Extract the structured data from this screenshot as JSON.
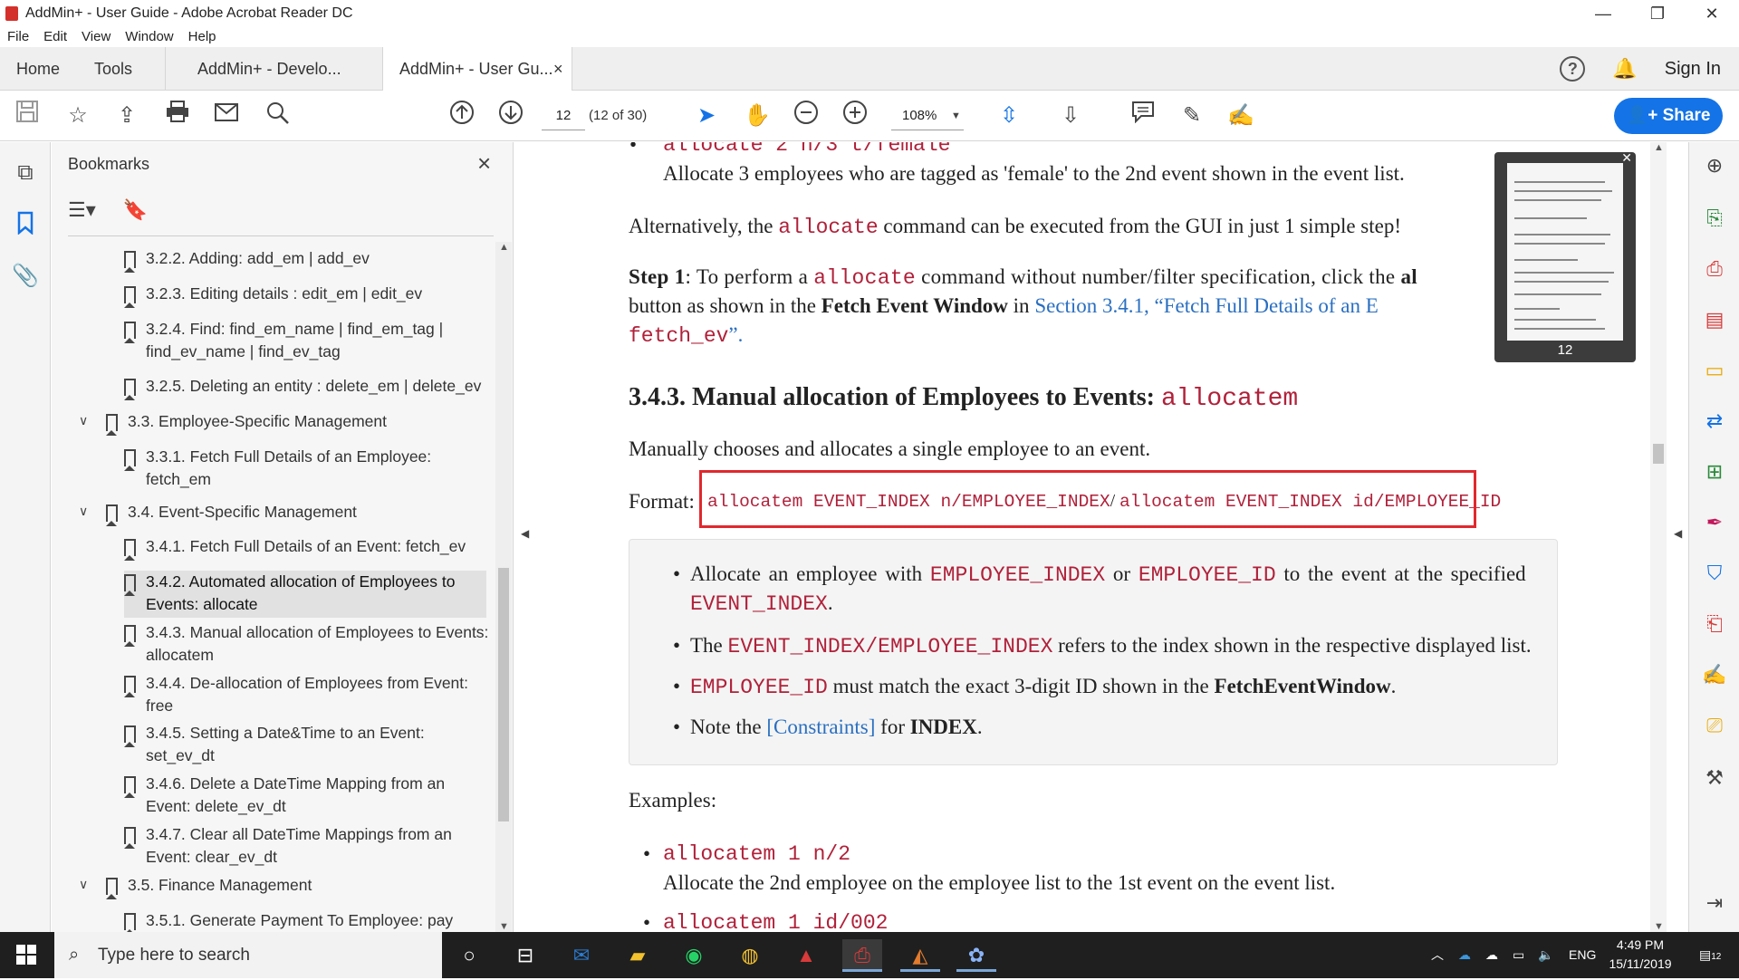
{
  "window": {
    "title": "AddMin+ - User Guide - Adobe Acrobat Reader DC",
    "minimize": "—",
    "restore": "❐",
    "close": "✕"
  },
  "menu": [
    "File",
    "Edit",
    "View",
    "Window",
    "Help"
  ],
  "tabs": {
    "home": "Home",
    "tools": "Tools",
    "doc1": "AddMin+ - Develo...",
    "doc2": "AddMin+ - User Gu...",
    "doc2_close": "×",
    "sign_in": "Sign In"
  },
  "toolbar": {
    "page_input": "12",
    "page_count": "(12 of 30)",
    "zoom": "108%",
    "share": "Share"
  },
  "bookmarks": {
    "title": "Bookmarks",
    "items": [
      {
        "label": "3.2.2. Adding: add_em | add_ev"
      },
      {
        "label": "3.2.3. Editing details : edit_em | edit_ev"
      },
      {
        "label": "3.2.4. Find: find_em_name | find_em_tag | find_ev_name | find_ev_tag"
      },
      {
        "label": "3.2.5. Deleting an entity : delete_em | delete_ev"
      },
      {
        "label": "3.3. Employee-Specific Management"
      },
      {
        "label": "3.3.1. Fetch Full Details of an Employee: fetch_em"
      },
      {
        "label": "3.4. Event-Specific Management"
      },
      {
        "label": "3.4.1. Fetch Full Details of an Event: fetch_ev"
      },
      {
        "label": "3.4.2. Automated allocation of Employees to Events: allocate"
      },
      {
        "label": "3.4.3. Manual allocation of Employees to Events: allocatem"
      },
      {
        "label": "3.4.4. De-allocation of Employees from Event: free"
      },
      {
        "label": "3.4.5. Setting a Date&Time to an Event: set_ev_dt"
      },
      {
        "label": "3.4.6. Delete a DateTime Mapping from an Event: delete_ev_dt"
      },
      {
        "label": "3.4.7. Clear all DateTime Mappings from an Event: clear_ev_dt"
      },
      {
        "label": "3.5. Finance Management"
      },
      {
        "label": "3.5.1. Generate Payment To Employee: pay"
      }
    ]
  },
  "doc": {
    "top_code": "allocate 2 n/3 t/female",
    "top_desc": "Allocate 3 employees who are tagged as 'female' to the 2nd event shown in the event list.",
    "alt_pre": "Alternatively, the ",
    "alt_code": "allocate",
    "alt_post": " command can be executed from the GUI in just 1 simple step!",
    "step_label": "Step 1",
    "step_pre": ": To perform a ",
    "step_code": "allocate",
    "step_mid": " command without number/filter specification, click the ",
    "step_cut": "al",
    "step_l2a": "button as shown in the ",
    "step_l2b": "Fetch Event Window",
    "step_l2c": " in ",
    "step_link": "Section 3.4.1, “Fetch Full Details of an E",
    "step_l3_code": "fetch_ev",
    "step_l3_end": "”.",
    "heading_text": "3.4.3. Manual allocation of Employees to Events: ",
    "heading_code": "allocatem",
    "desc": "Manually chooses and allocates a single employee to an event.",
    "format_label": "Format:",
    "format_code1": "allocatem EVENT_INDEX n/EMPLOYEE_INDEX",
    "format_sep": "/ ",
    "format_code2": "allocatem EVENT_INDEX id/EMPLOYEE_ID",
    "b1_a": "Allocate an employee with ",
    "b1_c1": "EMPLOYEE_INDEX",
    "b1_b": " or ",
    "b1_c2": "EMPLOYEE_ID",
    "b1_c": " to the event at the specified",
    "b1_c3": "EVENT_INDEX",
    "b1_d": ".",
    "b2_a": "The ",
    "b2_c": "EVENT_INDEX/EMPLOYEE_INDEX",
    "b2_b": " refers to the index shown in the respective displayed list.",
    "b3_c": "EMPLOYEE_ID",
    "b3_a": " must match the exact 3-digit ID shown in the ",
    "b3_b": "FetchEventWindow",
    "b3_d": ".",
    "b4_a": "Note the ",
    "b4_link": "[Constraints]",
    "b4_b": " for ",
    "b4_c": "INDEX",
    "b4_d": ".",
    "examples": "Examples:",
    "ex1_code": "allocatem 1 n/2",
    "ex1_desc": "Allocate the 2nd employee on the employee list to the 1st event on the event list.",
    "ex2_code": "allocatem 1 id/002"
  },
  "thumbnail": {
    "page": "12"
  },
  "taskbar": {
    "search_placeholder": "Type here to search",
    "lang": "ENG",
    "time": "4:49 PM",
    "date": "15/11/2019",
    "notif": "12"
  },
  "colors": {
    "accent": "#1473e6",
    "code": "#b0213a",
    "link": "#2a6fc1",
    "highlight_box": "#e0282e"
  }
}
